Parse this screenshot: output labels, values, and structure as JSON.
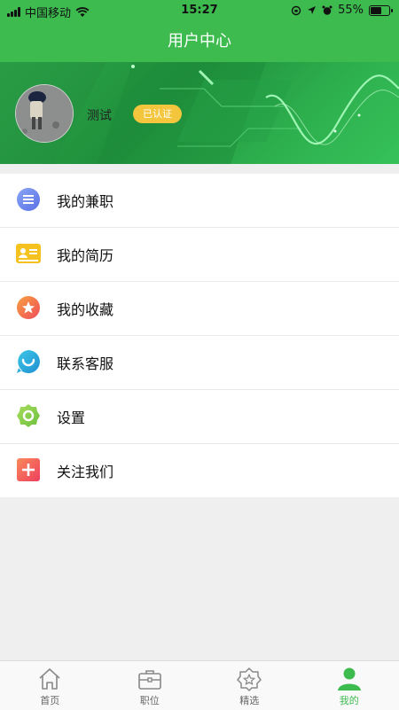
{
  "status_bar": {
    "carrier": "中国移动",
    "time": "15:27",
    "battery": "55%"
  },
  "nav": {
    "title": "用户中心"
  },
  "profile": {
    "username": "测试",
    "badge": "已认证"
  },
  "menu": [
    {
      "label": "我的兼职",
      "icon": "list-icon",
      "color": "#6f8ef0"
    },
    {
      "label": "我的简历",
      "icon": "id-card-icon",
      "color": "#f5c21f"
    },
    {
      "label": "我的收藏",
      "icon": "star-icon",
      "color": "#f06a4b"
    },
    {
      "label": "联系客服",
      "icon": "headset-icon",
      "color": "#29b3e0"
    },
    {
      "label": "设置",
      "icon": "gear-icon",
      "color": "#8bcf4a"
    },
    {
      "label": "关注我们",
      "icon": "plus-icon",
      "color": "#f2555b"
    }
  ],
  "tabs": [
    {
      "label": "首页",
      "icon": "home-icon",
      "active": false
    },
    {
      "label": "职位",
      "icon": "briefcase-icon",
      "active": false
    },
    {
      "label": "精选",
      "icon": "star-badge-icon",
      "active": false
    },
    {
      "label": "我的",
      "icon": "user-icon",
      "active": true
    }
  ],
  "colors": {
    "primary": "#3dbb4f",
    "badge": "#f4c63d"
  }
}
